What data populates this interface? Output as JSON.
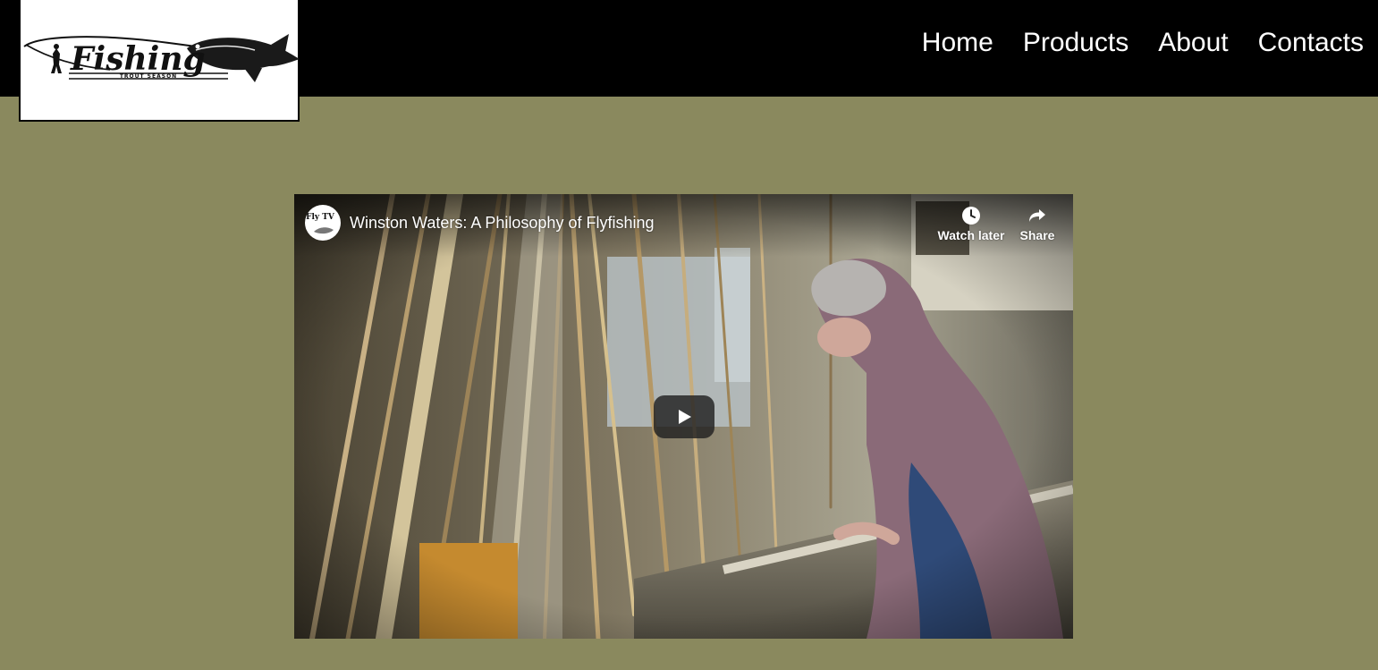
{
  "logo": {
    "text": "Fishing",
    "subtext": "TROUT SEASON"
  },
  "nav": {
    "items": [
      {
        "label": "Home"
      },
      {
        "label": "Products"
      },
      {
        "label": "About"
      },
      {
        "label": "Contacts"
      }
    ]
  },
  "video": {
    "title": "Winston Waters: A Philosophy of Flyfishing",
    "channel_avatar_text": "Fly TV",
    "watch_later_label": "Watch later",
    "share_label": "Share"
  },
  "colors": {
    "page_background": "#8a895e",
    "header_background": "#000000",
    "nav_text": "#ffffff"
  }
}
